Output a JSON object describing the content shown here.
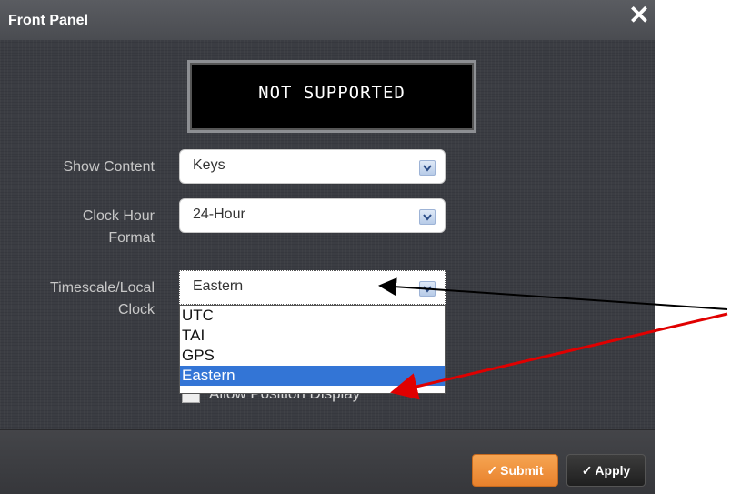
{
  "dialog": {
    "title": "Front Panel",
    "close_icon": "close-x-icon"
  },
  "display": {
    "text": "NOT SUPPORTED"
  },
  "fields": {
    "show_content": {
      "label": "Show Content",
      "value": "Keys"
    },
    "clock_hour_format": {
      "label_line1": "Clock Hour",
      "label_line2": "Format",
      "value": "24-Hour"
    },
    "timescale": {
      "label_line1": "Timescale/Local",
      "label_line2": "Clock",
      "value": "Eastern",
      "options": [
        "UTC",
        "TAI",
        "GPS",
        "Eastern"
      ],
      "selected_option": "Eastern"
    }
  },
  "checkbox": {
    "label": "Allow Position Display",
    "checked": false
  },
  "buttons": {
    "submit": "Submit",
    "apply": "Apply"
  },
  "colors": {
    "submit": "#f39a45",
    "selected_option": "#3375d6",
    "arrow_black": "#000000",
    "arrow_red": "#e00000"
  }
}
